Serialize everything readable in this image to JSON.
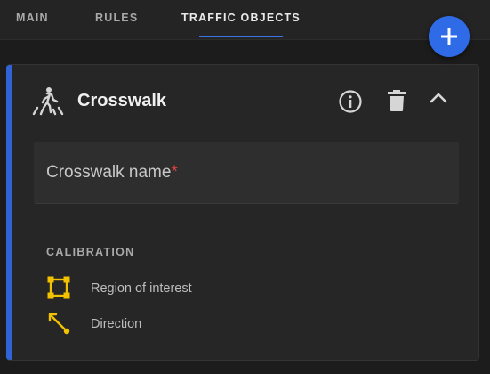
{
  "tabs": [
    {
      "label": "MAIN",
      "active": false
    },
    {
      "label": "RULES",
      "active": false
    },
    {
      "label": "TRAFFIC OBJECTS",
      "active": true
    }
  ],
  "fab": {
    "icon": "plus-icon",
    "color": "#2f6be6"
  },
  "card": {
    "title": "Crosswalk",
    "icon": "crosswalk-icon",
    "accent_color": "#3163d8",
    "actions": [
      "info-icon",
      "trash-icon",
      "chevron-up-icon"
    ],
    "name_field": {
      "label": "Crosswalk name",
      "required_marker": "*",
      "value": ""
    },
    "calibration": {
      "title": "CALIBRATION",
      "items": [
        {
          "label": "Region of interest",
          "icon": "region-of-interest-icon",
          "color": "#f2c200"
        },
        {
          "label": "Direction",
          "icon": "direction-icon",
          "color": "#f2c200"
        }
      ]
    }
  }
}
